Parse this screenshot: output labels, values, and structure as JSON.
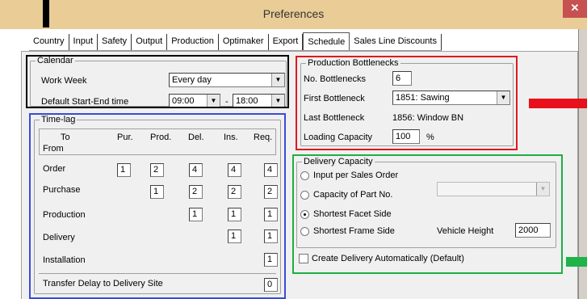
{
  "window": {
    "title": "Preferences",
    "close_glyph": "✕"
  },
  "tabs": [
    "Country",
    "Input",
    "Safety",
    "Output",
    "Production",
    "Optimaker",
    "Export",
    "Schedule",
    "Sales Line Discounts"
  ],
  "active_tab": "Schedule",
  "calendar": {
    "legend": "Calendar",
    "work_week_label": "Work Week",
    "work_week_value": "Every day",
    "start_end_label": "Default Start-End time",
    "start_time": "09:00",
    "dash": "-",
    "end_time": "18:00"
  },
  "timelag": {
    "legend": "Time-lag",
    "corner_to": "To",
    "corner_from": "From",
    "columns": [
      "Pur.",
      "Prod.",
      "Del.",
      "Ins.",
      "Req."
    ],
    "rows": [
      {
        "label": "Order",
        "values": [
          "1",
          "2",
          "4",
          "4",
          "4"
        ]
      },
      {
        "label": "Purchase",
        "values": [
          "",
          "1",
          "2",
          "2",
          "2"
        ]
      },
      {
        "label": "Production",
        "values": [
          "",
          "",
          "1",
          "1",
          "1"
        ]
      },
      {
        "label": "Delivery",
        "values": [
          "",
          "",
          "",
          "1",
          "1"
        ]
      },
      {
        "label": "Installation",
        "values": [
          "",
          "",
          "",
          "",
          "1"
        ]
      }
    ],
    "transfer_label": "Transfer Delay to Delivery Site",
    "transfer_value": "0"
  },
  "bottlenecks": {
    "legend": "Production Bottlenecks",
    "count_label": "No. Bottlenecks",
    "count_value": "6",
    "first_label": "First Bottleneck",
    "first_value": "1851: Sawing",
    "last_label": "Last Bottleneck",
    "last_value": "1856: Window BN",
    "loading_label": "Loading Capacity",
    "loading_value": "100",
    "loading_unit": "%"
  },
  "delivery": {
    "legend": "Delivery Capacity",
    "opt_input": "Input per Sales Order",
    "opt_part": "Capacity of Part No.",
    "opt_facet": "Shortest Facet Side",
    "opt_frame": "Shortest Frame Side",
    "selected": "Shortest Facet Side",
    "vehicle_label": "Vehicle Height",
    "vehicle_value": "2000",
    "auto_label": "Create Delivery Automatically (Default)"
  },
  "colors": {
    "titlebar": "#e9cc96",
    "close": "#c75050",
    "marker_red": "#e8101a",
    "marker_green": "#1fb34a",
    "highlight_blue": "#3a4bd8"
  }
}
